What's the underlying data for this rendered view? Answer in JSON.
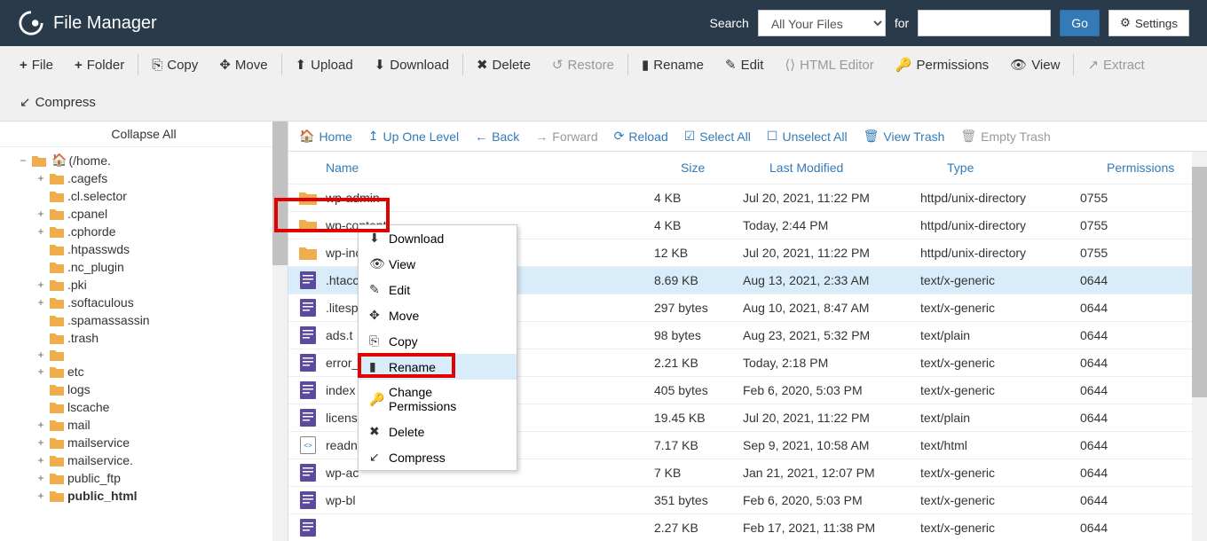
{
  "header": {
    "title": "File Manager",
    "search_label": "Search",
    "search_select": "All Your Files",
    "for_label": "for",
    "go": "Go",
    "settings": "Settings"
  },
  "toolbar": {
    "file": "File",
    "folder": "Folder",
    "copy": "Copy",
    "move": "Move",
    "upload": "Upload",
    "download": "Download",
    "delete": "Delete",
    "restore": "Restore",
    "rename": "Rename",
    "edit": "Edit",
    "html_editor": "HTML Editor",
    "permissions": "Permissions",
    "view": "View",
    "extract": "Extract",
    "compress": "Compress"
  },
  "sidebar": {
    "collapse": "Collapse All",
    "root": "(/home.",
    "items": [
      {
        "exp": "+",
        "label": ".cagefs"
      },
      {
        "exp": "",
        "label": ".cl.selector"
      },
      {
        "exp": "+",
        "label": ".cpanel"
      },
      {
        "exp": "+",
        "label": ".cphorde"
      },
      {
        "exp": "",
        "label": ".htpasswds"
      },
      {
        "exp": "",
        "label": ".nc_plugin"
      },
      {
        "exp": "+",
        "label": ".pki"
      },
      {
        "exp": "+",
        "label": ".softaculous"
      },
      {
        "exp": "",
        "label": ".spamassassin"
      },
      {
        "exp": "",
        "label": ".trash"
      },
      {
        "exp": "+",
        "label": ""
      },
      {
        "exp": "+",
        "label": "etc"
      },
      {
        "exp": "",
        "label": "logs"
      },
      {
        "exp": "",
        "label": "lscache"
      },
      {
        "exp": "+",
        "label": "mail"
      },
      {
        "exp": "+",
        "label": "mailservice"
      },
      {
        "exp": "+",
        "label": "mailservice."
      },
      {
        "exp": "+",
        "label": "public_ftp"
      },
      {
        "exp": "+",
        "label": "public_html",
        "bold": true
      }
    ]
  },
  "filebar": {
    "home": "Home",
    "up": "Up One Level",
    "back": "Back",
    "forward": "Forward",
    "reload": "Reload",
    "select_all": "Select All",
    "unselect_all": "Unselect All",
    "view_trash": "View Trash",
    "empty_trash": "Empty Trash"
  },
  "columns": {
    "name": "Name",
    "size": "Size",
    "modified": "Last Modified",
    "type": "Type",
    "perm": "Permissions"
  },
  "files": [
    {
      "icon": "folder",
      "name": "wp-admin",
      "size": "4 KB",
      "modified": "Jul 20, 2021, 11:22 PM",
      "type": "httpd/unix-directory",
      "perm": "0755"
    },
    {
      "icon": "folder",
      "name": "wp-content",
      "size": "4 KB",
      "modified": "Today, 2:44 PM",
      "type": "httpd/unix-directory",
      "perm": "0755"
    },
    {
      "icon": "folder",
      "name": "wp-includes",
      "size": "12 KB",
      "modified": "Jul 20, 2021, 11:22 PM",
      "type": "httpd/unix-directory",
      "perm": "0755"
    },
    {
      "icon": "doc",
      "name": ".htaccess",
      "size": "8.69 KB",
      "modified": "Aug 13, 2021, 2:33 AM",
      "type": "text/x-generic",
      "perm": "0644",
      "selected": true
    },
    {
      "icon": "doc",
      "name": ".litesp",
      "size": "297 bytes",
      "modified": "Aug 10, 2021, 8:47 AM",
      "type": "text/x-generic",
      "perm": "0644"
    },
    {
      "icon": "doc",
      "name": "ads.t",
      "size": "98 bytes",
      "modified": "Aug 23, 2021, 5:32 PM",
      "type": "text/plain",
      "perm": "0644"
    },
    {
      "icon": "doc",
      "name": "error_",
      "size": "2.21 KB",
      "modified": "Today, 2:18 PM",
      "type": "text/x-generic",
      "perm": "0644"
    },
    {
      "icon": "doc",
      "name": "index",
      "size": "405 bytes",
      "modified": "Feb 6, 2020, 5:03 PM",
      "type": "text/x-generic",
      "perm": "0644"
    },
    {
      "icon": "doc",
      "name": "licens",
      "size": "19.45 KB",
      "modified": "Jul 20, 2021, 11:22 PM",
      "type": "text/plain",
      "perm": "0644"
    },
    {
      "icon": "html",
      "name": "readn",
      "size": "7.17 KB",
      "modified": "Sep 9, 2021, 10:58 AM",
      "type": "text/html",
      "perm": "0644"
    },
    {
      "icon": "doc",
      "name": "wp-ac",
      "size": "7 KB",
      "modified": "Jan 21, 2021, 12:07 PM",
      "type": "text/x-generic",
      "perm": "0644"
    },
    {
      "icon": "doc",
      "name": "wp-bl",
      "size": "351 bytes",
      "modified": "Feb 6, 2020, 5:03 PM",
      "type": "text/x-generic",
      "perm": "0644"
    },
    {
      "icon": "doc",
      "name": "",
      "size": "2.27 KB",
      "modified": "Feb 17, 2021, 11:38 PM",
      "type": "text/x-generic",
      "perm": "0644"
    }
  ],
  "context_menu": {
    "download": "Download",
    "view": "View",
    "edit": "Edit",
    "move": "Move",
    "copy": "Copy",
    "rename": "Rename",
    "change_perms": "Change Permissions",
    "delete": "Delete",
    "compress": "Compress"
  }
}
